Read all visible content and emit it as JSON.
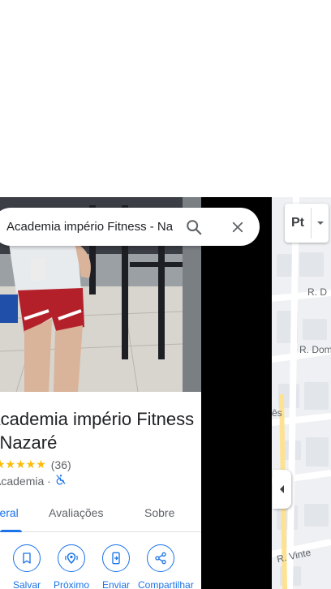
{
  "search": {
    "value": "Academia império Fitness - Na"
  },
  "place": {
    "title": "Academia império Fitness - Nazaré",
    "rating_stars": "★★★★★",
    "rating_count": "(36)",
    "category": "Academia ·"
  },
  "tabs": [
    {
      "label": "Visão geral",
      "active": true
    },
    {
      "label": "Avaliações",
      "active": false
    },
    {
      "label": "Sobre",
      "active": false
    }
  ],
  "actions": [
    {
      "label": "Salvar",
      "icon": "bookmark-icon"
    },
    {
      "label": "Próximo",
      "icon": "nearby-icon"
    },
    {
      "label": "Enviar",
      "icon": "send-to-phone-icon"
    },
    {
      "label": "Compartilhar",
      "icon": "share-icon"
    }
  ],
  "map": {
    "layer_label": "Pt",
    "roads": [
      "R. D",
      "R. Dom",
      "rês",
      "R. Vinte"
    ]
  },
  "colors": {
    "accent": "#1a73e8",
    "star": "#fbbc04",
    "map_bg": "#eef0f3"
  }
}
